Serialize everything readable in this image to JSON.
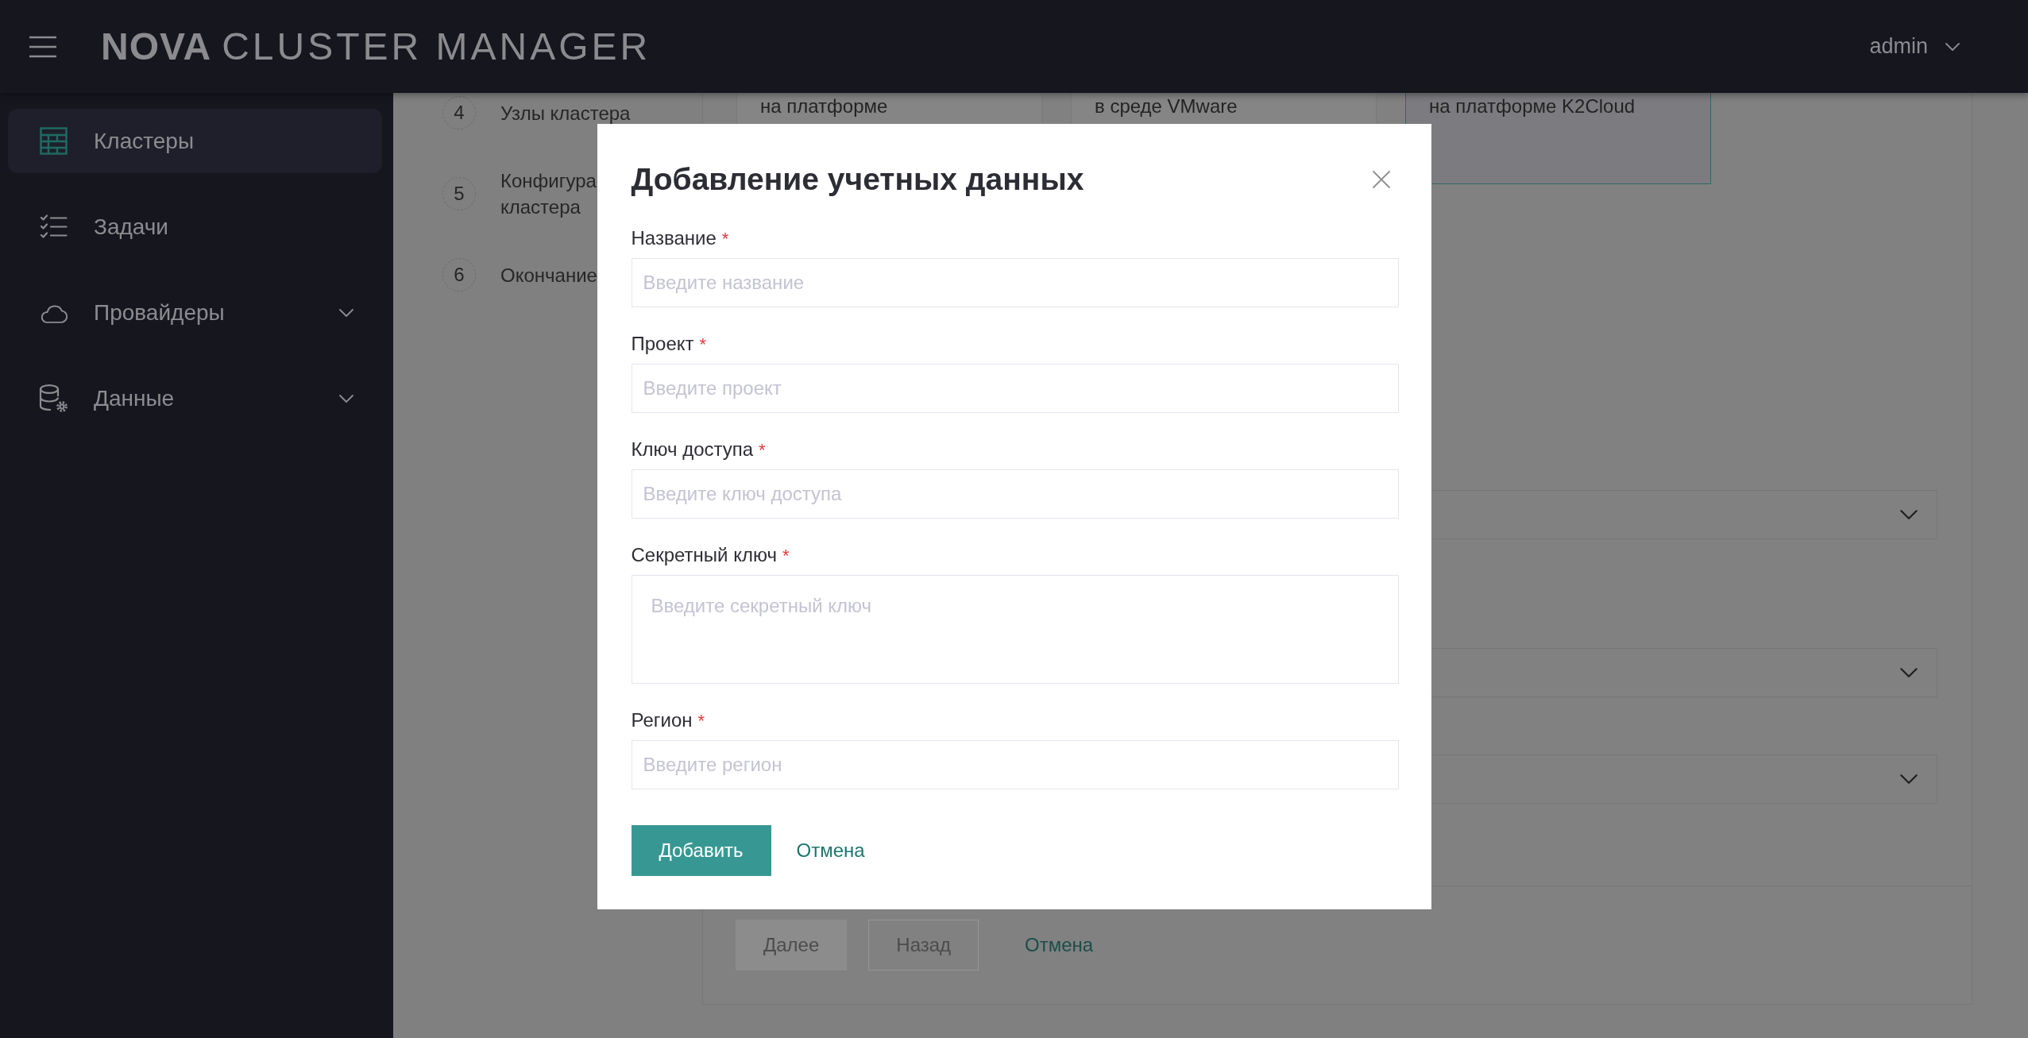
{
  "header": {
    "logo_mark": "NOVA",
    "title": "CLUSTER MANAGER",
    "user": "admin"
  },
  "sidebar": {
    "items": [
      {
        "label": "Кластеры",
        "kind": "link",
        "selected": true
      },
      {
        "label": "Задачи",
        "kind": "link",
        "selected": false
      },
      {
        "label": "Провайдеры",
        "kind": "group",
        "selected": false,
        "expanded": false
      },
      {
        "label": "Данные",
        "kind": "group",
        "selected": false,
        "expanded": false
      }
    ]
  },
  "wizard": {
    "steps": [
      {
        "number": "4",
        "label": "Узлы кластера"
      },
      {
        "number": "5",
        "label": "Конфигура\nкластера"
      },
      {
        "number": "6",
        "label": "Окончание"
      }
    ],
    "provider_cards": [
      {
        "text": "на платформе",
        "selected": false
      },
      {
        "text": "в среде VMware",
        "selected": false
      },
      {
        "text": "на платформе K2Cloud",
        "selected": true
      }
    ],
    "dropdowns": [
      {
        "expanded": false
      },
      {
        "expanded": false
      },
      {
        "expanded": false
      }
    ],
    "footer_buttons": [
      {
        "label": "Далее",
        "kind": "primary",
        "disabled": true
      },
      {
        "label": "Назад",
        "kind": "secondary",
        "disabled": true
      },
      {
        "label": "Отмена",
        "kind": "link",
        "disabled": false
      }
    ]
  },
  "modal": {
    "title": "Добавление учетных данных",
    "fields": [
      {
        "label": "Название",
        "marker": "*",
        "kind": "input",
        "placeholder": "Введите название"
      },
      {
        "label": "Проект",
        "marker": "*",
        "kind": "input",
        "placeholder": "Введите проект"
      },
      {
        "label": "Ключ доступа",
        "marker": "*",
        "kind": "input",
        "placeholder": "Введите ключ доступа"
      },
      {
        "label": "Секретный ключ",
        "marker": "*",
        "kind": "textarea",
        "placeholder": "Введите секретный ключ"
      },
      {
        "label": "Регион",
        "marker": "*",
        "kind": "input",
        "placeholder": "Введите регион"
      }
    ],
    "buttons": [
      {
        "label": "Добавить",
        "kind": "primary",
        "disabled": false
      },
      {
        "label": "Отмена",
        "kind": "link",
        "disabled": false
      }
    ]
  }
}
